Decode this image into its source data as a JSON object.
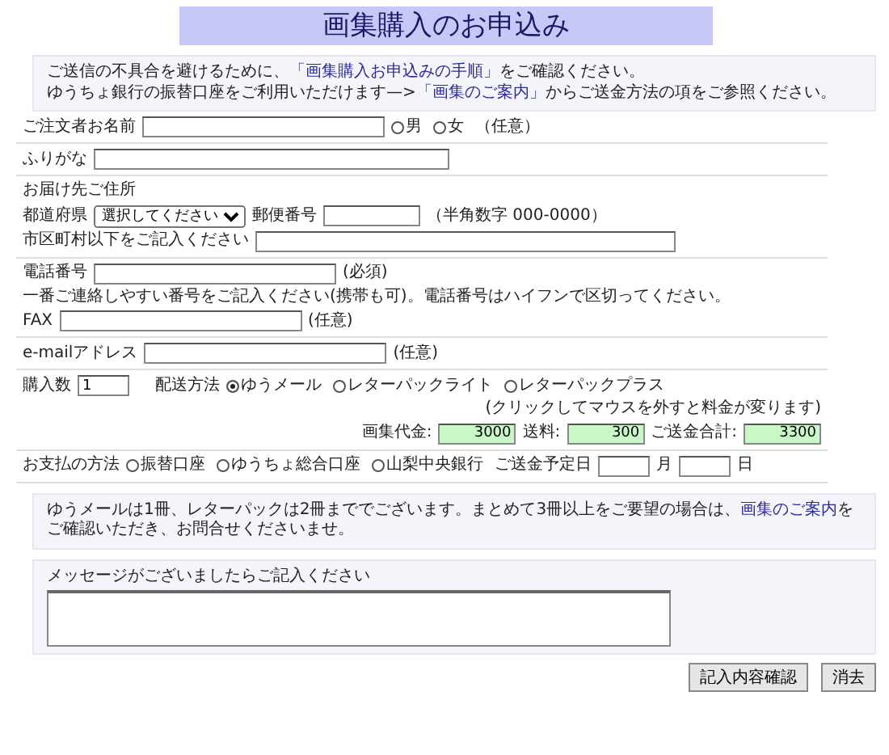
{
  "title": "画集購入のお申込み",
  "notice": [
    {
      "segments": [
        {
          "kind": "text",
          "text": "ご送信の不具合を避けるために、"
        },
        {
          "kind": "link",
          "text": "「画集購入お申込みの手順」"
        },
        {
          "kind": "text",
          "text": "をご確認ください。"
        }
      ]
    },
    {
      "segments": [
        {
          "kind": "text",
          "text": "ゆうちょ銀行の振替口座をご利用いただけます—>"
        },
        {
          "kind": "link",
          "text": "「画集のご案内」"
        },
        {
          "kind": "text",
          "text": "からご送金方法の項をご参照ください。"
        }
      ]
    }
  ],
  "name": {
    "label": "ご注文者お名前",
    "gender": [
      {
        "label": "男",
        "selected": false
      },
      {
        "label": "女",
        "selected": false
      }
    ],
    "note": "（任意）"
  },
  "furigana": {
    "label": "ふりがな"
  },
  "address": {
    "heading": "お届け先ご住所",
    "prefecture_label": "都道府県",
    "prefecture_select": "選択してください",
    "postal_label": "郵便番号",
    "postal_hint": "（半角数字 000-0000）",
    "city_label": "市区町村以下をご記入ください"
  },
  "phone": {
    "label": "電話番号",
    "note": "(必須)",
    "hint": "一番ご連絡しやすい番号をご記入ください(携帯も可)。電話番号はハイフンで区切ってください。"
  },
  "fax": {
    "label": "FAX",
    "note": "(任意)"
  },
  "email": {
    "label": "e-mailアドレス",
    "note": "(任意)"
  },
  "order": {
    "quantity_label": "購入数",
    "quantity": "1",
    "shipping_label": "配送方法",
    "shipping": [
      {
        "label": "ゆうメール",
        "selected": true
      },
      {
        "label": "レターパックライト",
        "selected": false
      },
      {
        "label": "レターパックプラス",
        "selected": false
      }
    ],
    "shipping_hint": "(クリックしてマウスを外すと料金が変ります)"
  },
  "totals": [
    {
      "label": "画集代金:",
      "value": "3000"
    },
    {
      "label": "送料:",
      "value": "300"
    },
    {
      "label": "ご送金合計:",
      "value": "3300"
    }
  ],
  "payment": {
    "label": "お支払の方法",
    "methods": [
      {
        "label": "振替口座",
        "selected": false
      },
      {
        "label": "ゆうちょ総合口座",
        "selected": false
      },
      {
        "label": "山梨中央銀行",
        "selected": false
      }
    ],
    "date_label": "ご送金予定日",
    "month": "月",
    "day": "日"
  },
  "info": {
    "segments": [
      {
        "kind": "text",
        "text": "ゆうメールは1冊、レターパックは2冊まででございます。まとめて3冊以上をご要望の場合は、"
      },
      {
        "kind": "link",
        "text": "画集のご案内"
      },
      {
        "kind": "text",
        "text": "をご確認いただき、お問合せくださいませ。"
      }
    ]
  },
  "message": {
    "label": "メッセージがございましたらご記入ください"
  },
  "buttons": [
    "記入内容確認",
    "消去"
  ]
}
